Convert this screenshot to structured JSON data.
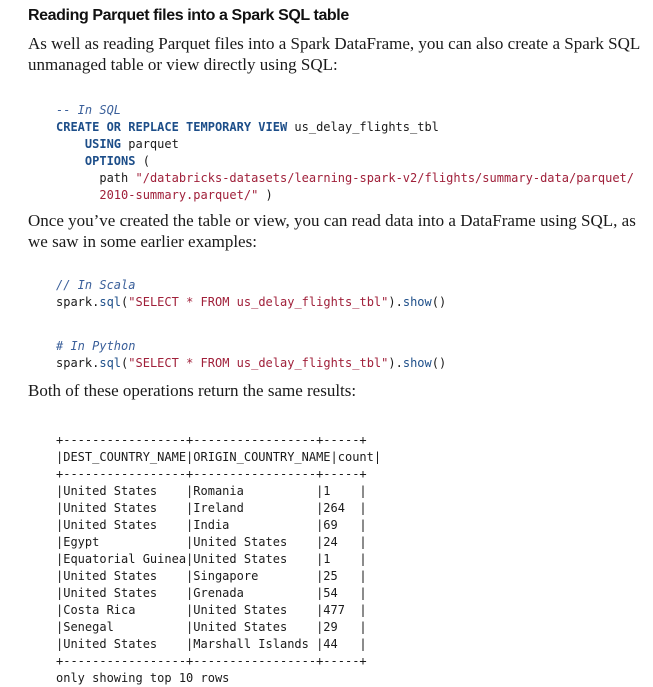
{
  "heading": "Reading Parquet files into a Spark SQL table",
  "para1": "As well as reading Parquet files into a Spark DataFrame, you can also create a Spark SQL unmanaged table or view directly using SQL:",
  "sql_code": {
    "comment": "-- In SQL",
    "line1_kw": "CREATE OR REPLACE TEMPORARY VIEW",
    "line1_rest": " us_delay_flights_tbl",
    "line2_kw": "USING",
    "line2_rest": " parquet",
    "line3_kw": "OPTIONS",
    "line3_rest": " (",
    "line4_path_kw": "path",
    "line4_str": "\"/databricks-datasets/learning-spark-v2/flights/summary-data/parquet/",
    "line5_str": "2010-summary.parquet/\"",
    "line5_rest": " )"
  },
  "para2": "Once you’ve created the table or view, you can read data into a DataFrame using SQL, as we saw in some earlier examples:",
  "scala_code": {
    "comment": "// In Scala",
    "prefix": "spark.",
    "fn": "sql",
    "open": "(",
    "str_a": "\"SELECT ",
    "op": "*",
    "str_b": " FROM us_delay_flights_tbl\"",
    "close": ").",
    "show": "show",
    "end": "()"
  },
  "python_code": {
    "comment": "# In Python",
    "prefix": "spark.",
    "fn": "sql",
    "open": "(",
    "str_a": "\"SELECT ",
    "op": "*",
    "str_b": " FROM us_delay_flights_tbl\"",
    "close": ").",
    "show": "show",
    "end": "()"
  },
  "para3": "Both of these operations return the same results:",
  "result_table": {
    "border": "+-----------------+-----------------+-----+",
    "header": "|DEST_COUNTRY_NAME|ORIGIN_COUNTRY_NAME|count|",
    "rows": [
      "|United States    |Romania          |1    |",
      "|United States    |Ireland          |264  |",
      "|United States    |India            |69   |",
      "|Egypt            |United States    |24   |",
      "|Equatorial Guinea|United States    |1    |",
      "|United States    |Singapore        |25   |",
      "|United States    |Grenada          |54   |",
      "|Costa Rica       |United States    |477  |",
      "|Senegal          |United States    |29   |",
      "|United States    |Marshall Islands |44   |"
    ],
    "footer": "only showing top 10 rows"
  }
}
